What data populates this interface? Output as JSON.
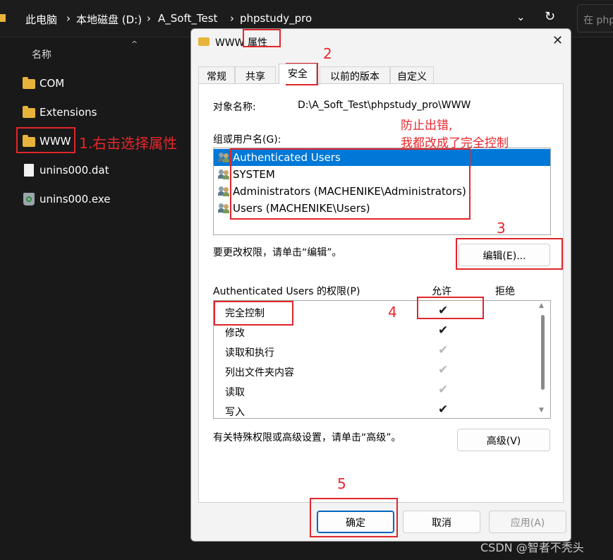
{
  "explorer": {
    "breadcrumbs": [
      "此电脑",
      "本地磁盘 (D:)",
      "A_Soft_Test",
      "phpstudy_pro"
    ],
    "search_placeholder": "在 php",
    "column_header": "名称",
    "files": [
      {
        "name": "COM",
        "type": "folder"
      },
      {
        "name": "Extensions",
        "type": "folder"
      },
      {
        "name": "WWW",
        "type": "folder"
      },
      {
        "name": "unins000.dat",
        "type": "file"
      },
      {
        "name": "unins000.exe",
        "type": "executable"
      }
    ]
  },
  "dialog": {
    "title": "WWW 属性",
    "tabs": [
      "常规",
      "共享",
      "安全",
      "以前的版本",
      "自定义"
    ],
    "active_tab": "安全",
    "object_name_label": "对象名称:",
    "object_name_value": "D:\\A_Soft_Test\\phpstudy_pro\\WWW",
    "groups_label": "组或用户名(G):",
    "users": [
      "Authenticated Users",
      "SYSTEM",
      "Administrators (MACHENIKE\\Administrators)",
      "Users (MACHENIKE\\Users)"
    ],
    "edit_hint": "要更改权限，请单击“编辑”。",
    "edit_button": "编辑(E)...",
    "permissions_label": "Authenticated Users 的权限(P)",
    "allow_header": "允许",
    "deny_header": "拒绝",
    "permissions": [
      {
        "name": "完全控制",
        "allow": "✔",
        "state": "on"
      },
      {
        "name": "修改",
        "allow": "✔",
        "state": "on"
      },
      {
        "name": "读取和执行",
        "allow": "✔",
        "state": "inherited"
      },
      {
        "name": "列出文件夹内容",
        "allow": "✔",
        "state": "inherited"
      },
      {
        "name": "读取",
        "allow": "✔",
        "state": "inherited"
      },
      {
        "name": "写入",
        "allow": "✔",
        "state": "on"
      }
    ],
    "advanced_hint": "有关特殊权限或高级设置，请单击“高级”。",
    "advanced_button": "高级(V)",
    "ok_button": "确定",
    "cancel_button": "取消",
    "apply_button": "应用(A)"
  },
  "annotations": {
    "step1": "1.右击选择属性",
    "step2": "2",
    "step3": "3",
    "step4": "4",
    "step5": "5",
    "note_line1": "防止出错,",
    "note_line2": "我都改成了完全控制"
  },
  "watermark": "CSDN @智者不秃头",
  "colors": {
    "annotation_red": "#e0262b",
    "selection_blue": "#0078d7",
    "folder_yellow": "#e8b33a",
    "explorer_bg": "#191919"
  }
}
